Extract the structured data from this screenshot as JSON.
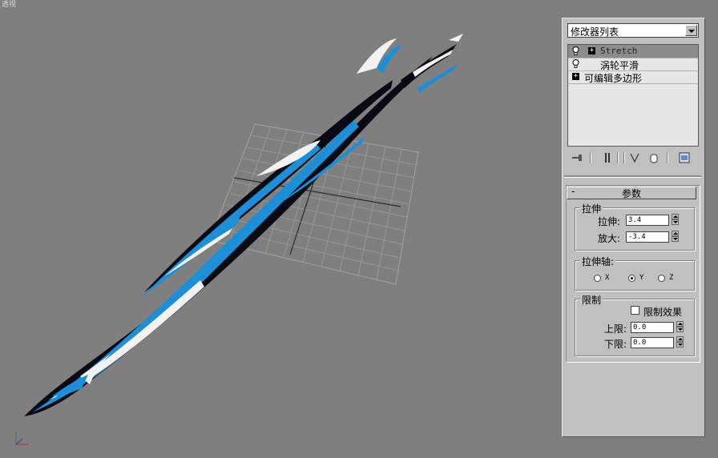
{
  "viewport": {
    "label": "透视"
  },
  "panel": {
    "modifier_list": "修改器列表",
    "stack": [
      {
        "name": "Stretch",
        "selected": true
      },
      {
        "name": "涡轮平滑",
        "selected": false
      },
      {
        "name": "可编辑多边形",
        "selected": false
      }
    ],
    "toolbar_icons": [
      "pin-stack-icon",
      "show-end-result-icon",
      "make-unique-icon",
      "remove-modifier-icon",
      "configure-modifier-sets-icon"
    ]
  },
  "rollout": {
    "collapse": "-",
    "title": "参数",
    "stretch_group": {
      "title": "拉伸",
      "stretch_label": "拉伸:",
      "stretch_value": "3.4",
      "amplify_label": "放大:",
      "amplify_value": "-3.4"
    },
    "axis_group": {
      "title": "拉伸轴:",
      "options": [
        "X",
        "Y",
        "Z"
      ],
      "selected": "Y"
    },
    "limits_group": {
      "title": "限制",
      "effect_label": "限制效果",
      "effect_checked": false,
      "upper_label": "上限:",
      "upper_value": "0.0",
      "lower_label": "下限:",
      "lower_value": "0.0"
    }
  },
  "colors": {
    "viewport_bg": "#7f7f7f",
    "panel_bg": "#c0c0c0",
    "object_blue": "#1e8fd6",
    "object_dark": "#0a0a14",
    "object_white": "#f2f2f2"
  }
}
